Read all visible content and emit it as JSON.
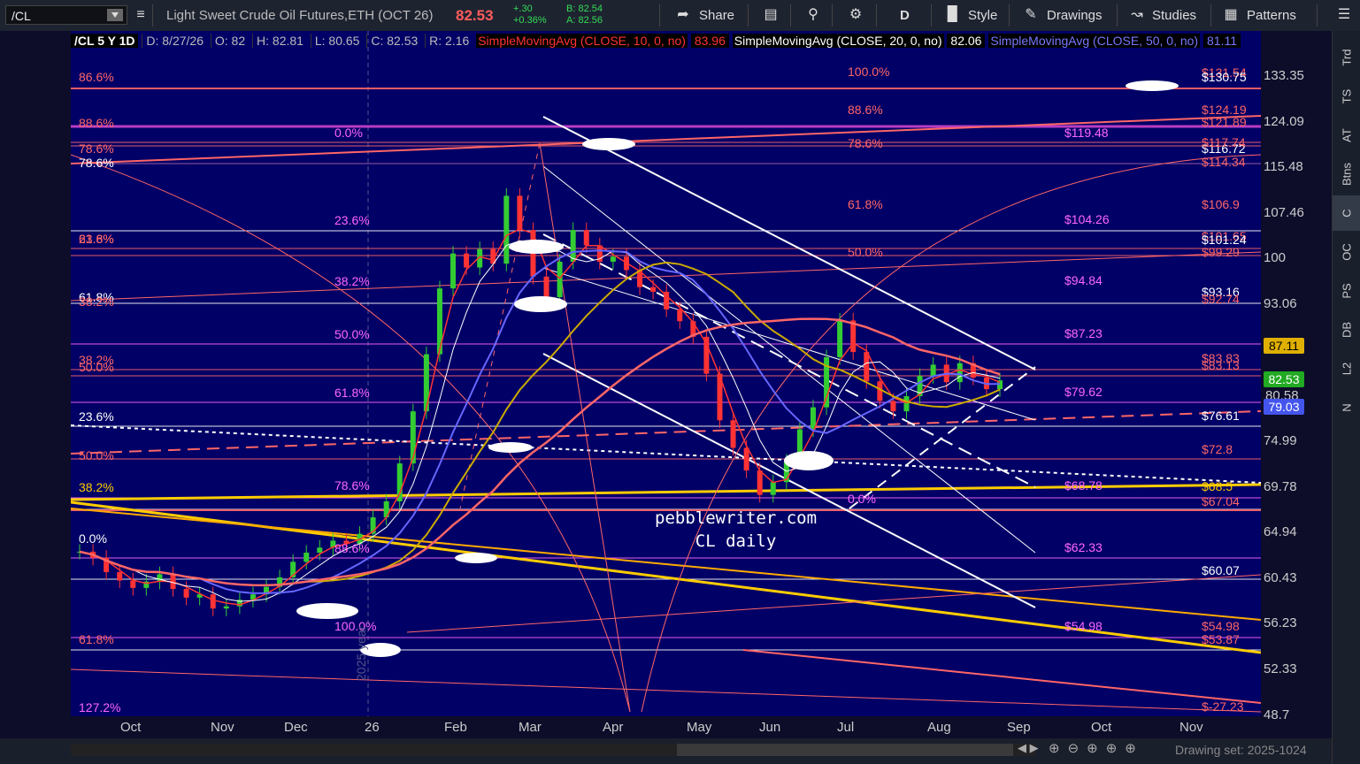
{
  "toolbar": {
    "symbol": "/CL",
    "instrument": "Light Sweet Crude Oil Futures,ETH (OCT 26)",
    "last": "82.53",
    "change": "+.30",
    "change_pct": "+0.36%",
    "bid": "B: 82.54",
    "ask": "A: 82.56",
    "share": "Share",
    "period": "D",
    "style": "Style",
    "drawings": "Drawings",
    "studies": "Studies",
    "patterns": "Patterns"
  },
  "info": {
    "sym": "/CL 5 Y 1D",
    "date": "D: 8/27/26",
    "open": "O: 82",
    "high": "H: 82.81",
    "low": "L: 80.65",
    "close": "C: 82.53",
    "range": "R: 2.16",
    "sma10": "SimpleMovingAvg (CLOSE, 10, 0, no)",
    "sma10_val": "83.96",
    "sma20": "SimpleMovingAvg (CLOSE, 20, 0, no)",
    "sma20_val": "82.06",
    "sma50": "SimpleMovingAvg (CLOSE, 50, 0, no)",
    "sma50_val": "81.11"
  },
  "sidebar": [
    "Trd",
    "TS",
    "AT",
    "Btns",
    "C",
    "OC",
    "PS",
    "DB",
    "L2",
    "N"
  ],
  "footer": {
    "drawing_set": "Drawing set: 2025-1024"
  },
  "watermark": {
    "line1": "pebblewriter.com",
    "line2": "CL daily"
  },
  "year_mark": "2025 year",
  "tags": {
    "sma50_tag": "87.11",
    "last_tag": "82.53",
    "sma200_tag": "79.03",
    "under_last": "80.58"
  },
  "colors": {
    "background": "#000066",
    "up": "#33cc33",
    "down": "#ff3333",
    "sma10": "#ff3333",
    "sma20": "#ffffff",
    "sma50": "#6666ff",
    "sma100": "#ccaa00",
    "sma200": "#ff6666",
    "gold": "#ffcc00",
    "fib_pink": "#ff66ff",
    "fib_red": "#ff6666"
  },
  "fib_labels": {
    "left": [
      "86.6%",
      "88.6%",
      "78.6%",
      "78.6%",
      "23.6%",
      "61.8%",
      "61.8%",
      "38.2%",
      "38.2%",
      "50.0%",
      "23.6%",
      "50.0%",
      "38.2%",
      "0.0%",
      "61.8%",
      "127.2%"
    ],
    "mid": [
      "0.0%",
      "23.6%",
      "38.2%",
      "50.0%",
      "61.8%",
      "78.6%",
      "88.6%",
      "100.0%",
      "0.0%"
    ],
    "right_pct": [
      "100.0%",
      "88.6%",
      "78.6%",
      "61.8%",
      "50.0%"
    ],
    "right_price": [
      "$119.48",
      "$104.26",
      "$94.84",
      "$87.23",
      "$79.62",
      "$68.78",
      "$62.33",
      "$54.98"
    ],
    "far_right": [
      "$131.54",
      "$130.75",
      "$124.19",
      "$121.89",
      "$116.72",
      "$117.74",
      "$114.34",
      "$106.9",
      "$101.65",
      "$101.24",
      "$99.29",
      "$93.16",
      "$92.74",
      "$83.83",
      "$83.13",
      "$76.61",
      "$72.8",
      "$68.5",
      "$67.04",
      "$60.07",
      "$54.98",
      "$53.87",
      "$-27.23"
    ]
  },
  "chart_data": {
    "type": "candlestick",
    "x_ticks": [
      "Oct",
      "Nov",
      "Dec",
      "26",
      "Feb",
      "Mar",
      "Apr",
      "May",
      "Jun",
      "Jul",
      "Aug",
      "Sep",
      "Oct",
      "Nov"
    ],
    "y_ticks": [
      133.35,
      124.09,
      115.48,
      107.46,
      100,
      93.06,
      74.99,
      69.78,
      64.94,
      60.43,
      56.23,
      52.33,
      48.7
    ],
    "scale": "log",
    "ylim": [
      48.7,
      140
    ],
    "series_closes": [
      63,
      62.4,
      61,
      60.2,
      59.5,
      60.1,
      60.8,
      59.4,
      58.6,
      58.9,
      57.6,
      57.8,
      58.4,
      58.9,
      59.6,
      60.5,
      62,
      62.9,
      63.4,
      64.1,
      63.8,
      64.8,
      66.5,
      68.2,
      72.4,
      78.6,
      86,
      95.4,
      100.8,
      98.6,
      101.5,
      99.2,
      110.4,
      104.6,
      97.2,
      94.1,
      99.5,
      104.6,
      102.1,
      99.5,
      100.3,
      98.2,
      95.6,
      94.9,
      92.3,
      90.6,
      88.4,
      83.4,
      77.5,
      74.2,
      71.6,
      68.9,
      70.3,
      72.6,
      76.4,
      79.1,
      85.6,
      90.7,
      86.3,
      82.4,
      79.9,
      78.6,
      80.5,
      83.1,
      84.6,
      82.3,
      84.8,
      82.9,
      81.4,
      82.53
    ],
    "sma_levels": {
      "sma10": 83.96,
      "sma20": 82.06,
      "sma50": 81.11
    }
  }
}
